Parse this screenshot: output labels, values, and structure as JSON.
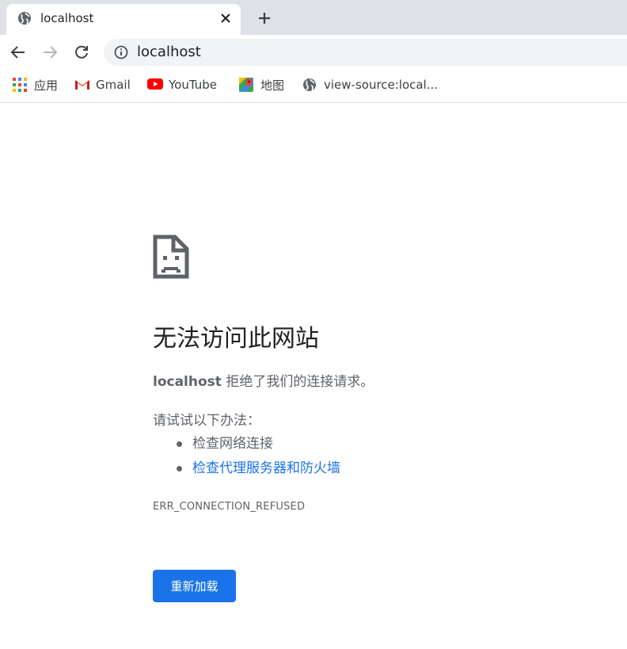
{
  "tab": {
    "title": "localhost",
    "favicon_icon": "globe-icon",
    "close_icon": "close-icon"
  },
  "newtab_icon": "plus-icon",
  "nav": {
    "back_icon": "arrow-back-icon",
    "forward_icon": "arrow-forward-icon",
    "reload_icon": "reload-icon"
  },
  "omnibox": {
    "security_icon": "info-icon",
    "url": "localhost"
  },
  "bookmarks": [
    {
      "label": "应用",
      "icon": "apps-grid-icon"
    },
    {
      "label": "Gmail",
      "icon": "gmail-icon"
    },
    {
      "label": "YouTube",
      "icon": "youtube-icon"
    },
    {
      "label": "地图",
      "icon": "maps-icon"
    },
    {
      "label": "view-source:local...",
      "icon": "globe-icon"
    }
  ],
  "error": {
    "icon": "sad-page-icon",
    "title": "无法访问此网站",
    "host": "localhost",
    "detail": " 拒绝了我们的连接请求。",
    "suggestions_heading": "请试试以下办法：",
    "suggestions": [
      "检查网络连接",
      "检查代理服务器和防火墙"
    ],
    "code": "ERR_CONNECTION_REFUSED",
    "reload_label": "重新加载"
  },
  "colors": {
    "accent": "#1a73e8",
    "text_secondary": "#5f6368",
    "tabstrip_bg": "#dee1e6"
  }
}
